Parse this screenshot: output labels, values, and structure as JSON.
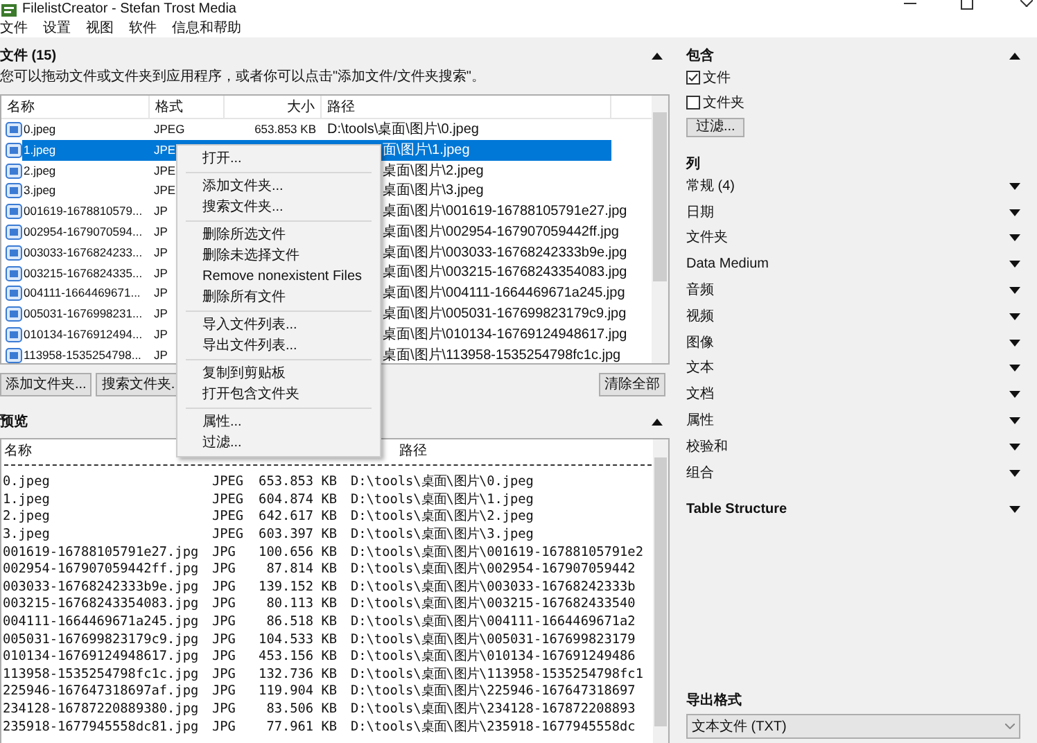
{
  "window": {
    "title": "FilelistCreator - Stefan Trost Media"
  },
  "menu_bar": [
    "文件",
    "设置",
    "视图",
    "软件",
    "信息和帮助"
  ],
  "files_section": {
    "title": "文件 (15)",
    "expanded": true,
    "hint": "您可以拖动文件或文件夹到应用程序，或者你可以点击\"添加文件/文件夹搜索\"。",
    "columns": [
      "名称",
      "格式",
      "大小",
      "路径"
    ],
    "rows": [
      {
        "name": "0.jpeg",
        "format": "JPEG",
        "size": "653.853 KB",
        "path": "D:\\tools\\桌面\\图片\\0.jpeg",
        "selected": false
      },
      {
        "name": "1.jpeg",
        "format": "JPE",
        "path": "面\\图片\\1.jpeg",
        "selected": true
      },
      {
        "name": "2.jpeg",
        "format": "JPE",
        "path": "桌面\\图片\\2.jpeg",
        "selected": false
      },
      {
        "name": "3.jpeg",
        "format": "JPE",
        "path": "桌面\\图片\\3.jpeg",
        "selected": false
      },
      {
        "name": "001619-1678810579...",
        "format": "JP",
        "path": "桌面\\图片\\001619-16788105791e27.jpg",
        "selected": false
      },
      {
        "name": "002954-1679070594...",
        "format": "JP",
        "path": "桌面\\图片\\002954-167907059442ff.jpg",
        "selected": false
      },
      {
        "name": "003033-1676824233...",
        "format": "JP",
        "path": "桌面\\图片\\003033-16768242333b9e.jpg",
        "selected": false
      },
      {
        "name": "003215-1676824335...",
        "format": "JP",
        "path": "桌面\\图片\\003215-16768243354083.jpg",
        "selected": false
      },
      {
        "name": "004111-1664469671...",
        "format": "JP",
        "path": "桌面\\图片\\004111-1664469671a245.jpg",
        "selected": false
      },
      {
        "name": "005031-1676998231...",
        "format": "JP",
        "path": "桌面\\图片\\005031-167699823179c9.jpg",
        "selected": false
      },
      {
        "name": "010134-1676912494...",
        "format": "JP",
        "path": "桌面\\图片\\010134-16769124948617.jpg",
        "selected": false
      },
      {
        "name": "113958-1535254798...",
        "format": "JP",
        "path": "桌面\\图片\\113958-1535254798fc1c.jpg",
        "selected": false
      }
    ],
    "buttons": [
      {
        "label": "添加文件夹..."
      },
      {
        "label": "搜索文件夹."
      },
      {
        "label": "清除全部"
      }
    ]
  },
  "context_menu": [
    {
      "kind": "item",
      "label": "打开..."
    },
    {
      "kind": "separator"
    },
    {
      "kind": "item",
      "label": "添加文件夹..."
    },
    {
      "kind": "item",
      "label": "搜索文件夹..."
    },
    {
      "kind": "separator"
    },
    {
      "kind": "item",
      "label": "删除所选文件"
    },
    {
      "kind": "item",
      "label": "删除未选择文件"
    },
    {
      "kind": "item",
      "label": "Remove nonexistent Files"
    },
    {
      "kind": "item",
      "label": "删除所有文件"
    },
    {
      "kind": "separator"
    },
    {
      "kind": "item",
      "label": "导入文件列表..."
    },
    {
      "kind": "item",
      "label": "导出文件列表..."
    },
    {
      "kind": "separator"
    },
    {
      "kind": "item",
      "label": "复制到剪贴板"
    },
    {
      "kind": "item",
      "label": "打开包含文件夹"
    },
    {
      "kind": "separator"
    },
    {
      "kind": "item",
      "label": "属性..."
    },
    {
      "kind": "item",
      "label": "过滤..."
    }
  ],
  "preview_section": {
    "title": "预览",
    "expanded": true,
    "header": [
      "名称",
      "路径"
    ],
    "lines": [
      {
        "name": "0.jpeg",
        "format": "JPEG",
        "size": "653.853 KB",
        "path": "D:\\tools\\桌面\\图片\\0.jpeg"
      },
      {
        "name": "1.jpeg",
        "format": "JPEG",
        "size": "604.874 KB",
        "path": "D:\\tools\\桌面\\图片\\1.jpeg"
      },
      {
        "name": "2.jpeg",
        "format": "JPEG",
        "size": "642.617 KB",
        "path": "D:\\tools\\桌面\\图片\\2.jpeg"
      },
      {
        "name": "3.jpeg",
        "format": "JPEG",
        "size": "603.397 KB",
        "path": "D:\\tools\\桌面\\图片\\3.jpeg"
      },
      {
        "name": "001619-16788105791e27.jpg",
        "format": "JPG",
        "size": "100.656 KB",
        "path": "D:\\tools\\桌面\\图片\\001619-16788105791e2"
      },
      {
        "name": "002954-167907059442ff.jpg",
        "format": "JPG",
        "size": "87.814 KB",
        "path": "D:\\tools\\桌面\\图片\\002954-167907059442"
      },
      {
        "name": "003033-16768242333b9e.jpg",
        "format": "JPG",
        "size": "139.152 KB",
        "path": "D:\\tools\\桌面\\图片\\003033-16768242333b"
      },
      {
        "name": "003215-16768243354083.jpg",
        "format": "JPG",
        "size": "80.113 KB",
        "path": "D:\\tools\\桌面\\图片\\003215-167682433540"
      },
      {
        "name": "004111-1664469671a245.jpg",
        "format": "JPG",
        "size": "86.518 KB",
        "path": "D:\\tools\\桌面\\图片\\004111-1664469671a2"
      },
      {
        "name": "005031-167699823179c9.jpg",
        "format": "JPG",
        "size": "104.533 KB",
        "path": "D:\\tools\\桌面\\图片\\005031-167699823179"
      },
      {
        "name": "010134-16769124948617.jpg",
        "format": "JPG",
        "size": "453.156 KB",
        "path": "D:\\tools\\桌面\\图片\\010134-167691249486"
      },
      {
        "name": "113958-1535254798fc1c.jpg",
        "format": "JPG",
        "size": "132.736 KB",
        "path": "D:\\tools\\桌面\\图片\\113958-1535254798fc1"
      },
      {
        "name": "225946-167647318697af.jpg",
        "format": "JPG",
        "size": "119.904 KB",
        "path": "D:\\tools\\桌面\\图片\\225946-167647318697"
      },
      {
        "name": "234128-16787220889380.jpg",
        "format": "JPG",
        "size": "83.506 KB",
        "path": "D:\\tools\\桌面\\图片\\234128-167872208893"
      },
      {
        "name": "235918-1677945558dc81.jpg",
        "format": "JPG",
        "size": "77.961 KB",
        "path": "D:\\tools\\桌面\\图片\\235918-1677945558dc"
      }
    ]
  },
  "include_section": {
    "title": "包含",
    "expanded": true,
    "options": [
      {
        "label": "文件",
        "checked": true
      },
      {
        "label": "文件夹",
        "checked": false
      }
    ],
    "filter_button": "过滤..."
  },
  "columns_section": {
    "title": "列",
    "groups": [
      {
        "label": "常规 (4)",
        "bold": false
      },
      {
        "label": "日期",
        "bold": false
      },
      {
        "label": "文件夹",
        "bold": false
      },
      {
        "label": "Data Medium",
        "bold": false
      },
      {
        "label": "音频",
        "bold": false
      },
      {
        "label": "视频",
        "bold": false
      },
      {
        "label": "图像",
        "bold": false
      },
      {
        "label": "文本",
        "bold": false
      },
      {
        "label": "文档",
        "bold": false
      },
      {
        "label": "属性",
        "bold": false
      },
      {
        "label": "校验和",
        "bold": false
      },
      {
        "label": "组合",
        "bold": false
      },
      {
        "label": "Table Structure",
        "bold": true
      }
    ]
  },
  "export_format": {
    "title": "导出格式",
    "value": "文本文件 (TXT)"
  }
}
